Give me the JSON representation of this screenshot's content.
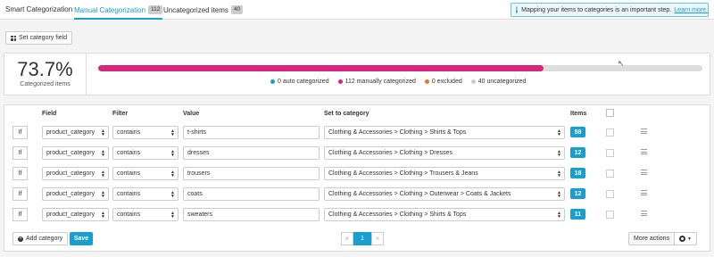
{
  "tabs": [
    {
      "label": "Smart Categorization",
      "badge": ""
    },
    {
      "label": "Manual Categorization",
      "badge": "112"
    },
    {
      "label": "Uncategorized items",
      "badge": "40"
    }
  ],
  "active_tab": "Manual Categorization",
  "info_banner": {
    "text": "Mapping your items to categories is an important step.",
    "link": "Learn more."
  },
  "set_category_button": "Set category field",
  "stats": {
    "percent": "73.7%",
    "label": "Categorized items",
    "progress_fraction": 0.737,
    "legend": [
      {
        "label": "0 auto categorized",
        "color": "#1a9ecf"
      },
      {
        "label": "112 manually categorized",
        "color": "#d6257e"
      },
      {
        "label": "0 excluded",
        "color": "#e07b2a"
      },
      {
        "label": "40 uncategorized",
        "color": "#cccccc"
      }
    ]
  },
  "table": {
    "headers": {
      "field": "Field",
      "filter": "Filter",
      "value": "Value",
      "set_to": "Set to category",
      "items": "Items"
    },
    "rows": [
      {
        "if": "If",
        "field": "product_category",
        "filter": "contains",
        "value": "t-shirts",
        "category": "Clothing & Accessories > Clothing > Shirts & Tops",
        "count": "59"
      },
      {
        "if": "If",
        "field": "product_category",
        "filter": "contains",
        "value": "dresses",
        "category": "Clothing & Accessories > Clothing > Dresses",
        "count": "12"
      },
      {
        "if": "If",
        "field": "product_category",
        "filter": "contains",
        "value": "trousers",
        "category": "Clothing & Accessories > Clothing > Trousers & Jeans",
        "count": "18"
      },
      {
        "if": "If",
        "field": "product_category",
        "filter": "contains",
        "value": "coats",
        "category": "Clothing & Accessories > Clothing > Outerwear > Coats & Jackets",
        "count": "12"
      },
      {
        "if": "If",
        "field": "product_category",
        "filter": "contains",
        "value": "sweaters",
        "category": "Clothing & Accessories > Clothing > Shirts & Tops",
        "count": "11"
      }
    ]
  },
  "footer": {
    "add_label": "Add category",
    "save_label": "Save",
    "pager_prev": "«",
    "pager_current": "1",
    "pager_next": "»",
    "more_actions": "More actions"
  }
}
